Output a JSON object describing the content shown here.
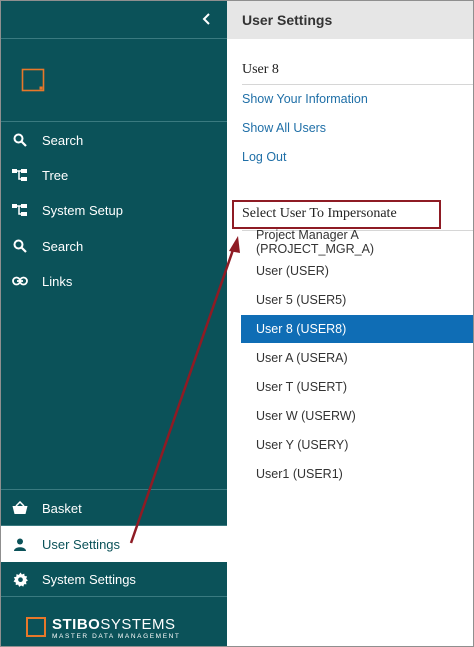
{
  "sidebar": {
    "collapse_icon": "chevron-left-icon",
    "nav_top": [
      {
        "label": "Search",
        "icon": "search-icon"
      },
      {
        "label": "Tree",
        "icon": "tree-icon"
      },
      {
        "label": "System Setup",
        "icon": "tree-icon"
      },
      {
        "label": "Search",
        "icon": "search-icon"
      },
      {
        "label": "Links",
        "icon": "link-icon"
      }
    ],
    "nav_bottom": [
      {
        "label": "Basket",
        "icon": "basket-icon"
      },
      {
        "label": "User Settings",
        "icon": "user-icon",
        "active": true
      },
      {
        "label": "System Settings",
        "icon": "gear-icon"
      }
    ],
    "brand": {
      "main_bold": "STIBO",
      "main_light": "SYSTEMS",
      "tagline": "MASTER DATA MANAGEMENT",
      "accent": "#e8782a"
    }
  },
  "main": {
    "title": "User Settings",
    "user_name": "User 8",
    "links": [
      "Show Your Information",
      "Show All Users",
      "Log Out"
    ],
    "impersonate_title": "Select User To Impersonate",
    "users": [
      "Project Manager A (PROJECT_MGR_A)",
      "User (USER)",
      "User 5 (USER5)",
      "User 8 (USER8)",
      "User A (USERA)",
      "User T (USERT)",
      "User W (USERW)",
      "User Y (USERY)",
      "User1 (USER1)"
    ],
    "selected_user": "User 8 (USER8)"
  },
  "colors": {
    "sidebar_bg": "#0b5259",
    "selected_row": "#0f6db5",
    "link": "#1f6fa7",
    "annotation": "#8e1b24"
  }
}
